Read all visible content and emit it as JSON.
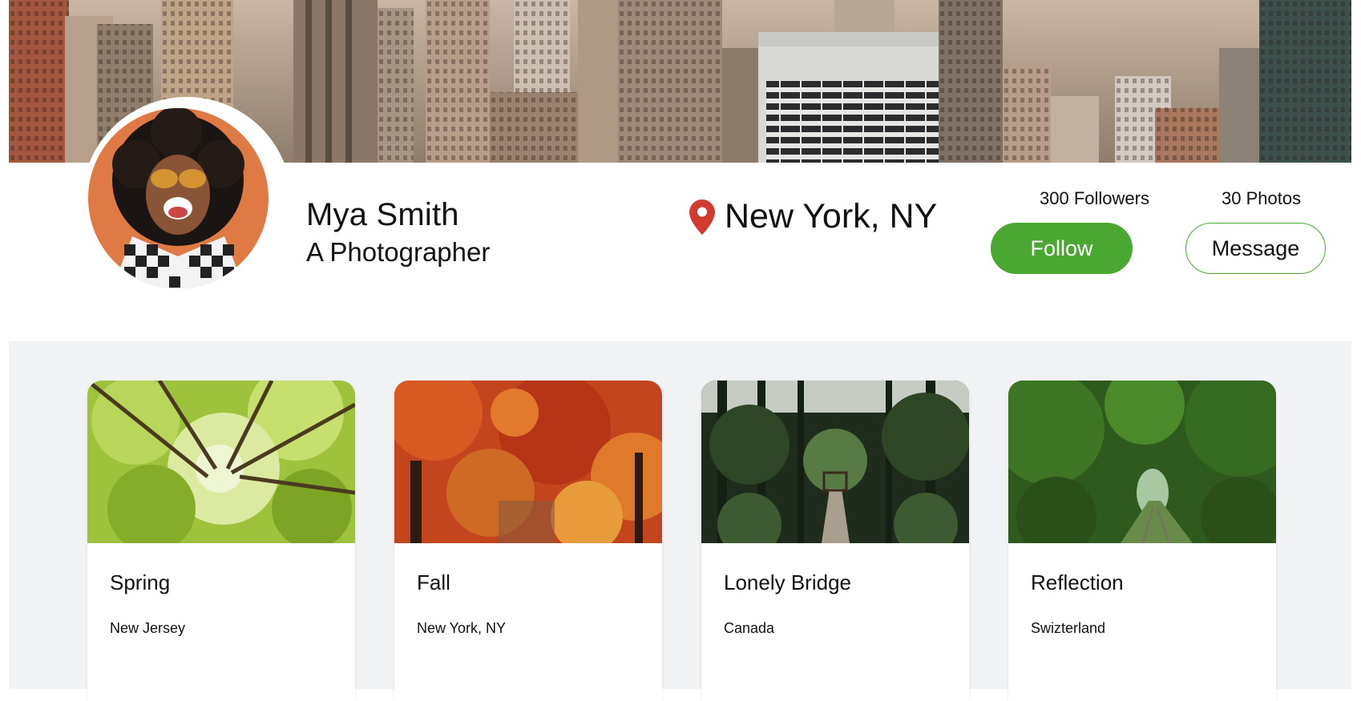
{
  "profile": {
    "name": "Mya Smith",
    "tagline": "A Photographer",
    "location": "New York, NY",
    "followers_label": "300 Followers",
    "photos_label": "30 Photos"
  },
  "actions": {
    "follow_label": "Follow",
    "message_label": "Message"
  },
  "icons": {
    "location": "map-pin-icon"
  },
  "colors": {
    "accent": "#4aa832",
    "pin": "#d33a2f",
    "gallery_background": "#f1f2f4"
  },
  "gallery": [
    {
      "title": "Spring",
      "place": "New Jersey"
    },
    {
      "title": "Fall",
      "place": "New York, NY"
    },
    {
      "title": "Lonely Bridge",
      "place": "Canada"
    },
    {
      "title": "Reflection",
      "place": "Swizterland"
    }
  ]
}
